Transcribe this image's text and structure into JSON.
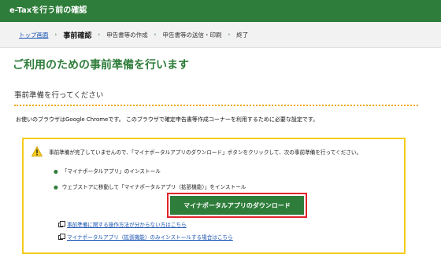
{
  "header": {
    "title": "e-Taxを行う前の確認"
  },
  "breadcrumb": {
    "top": "トップ画面",
    "current": "事前確認",
    "steps": [
      "申告書等の作成",
      "申告書等の送信・印刷",
      "終了"
    ]
  },
  "page_title": "ご利用のための事前準備を行います",
  "section_heading": "事前準備を行ってください",
  "browser_note": "お使いのブラウザはGoogle Chromeです。 このブラウザで確定申告書等作成コーナーを利用するために必要な設定です。",
  "notice": {
    "message": "事前準備が完了していませんので、「マイナポータルアプリのダウンロード」ボタンをクリックして、次の事前準備を行ってください。",
    "bullets": [
      "「マイナポータルアプリ」のインストール",
      "ウェブストアに移動して「マイナポータルアプリ（拡張機能）」をインストール"
    ],
    "download_button": "マイナポータルアプリのダウンロード",
    "links": [
      "事前準備に関する操作方法が分からない方はこちら",
      "マイナポータルアプリ（拡張機能）のみインストールする場合はこちら"
    ]
  },
  "colors": {
    "primary_green": "#2e7d3a",
    "warning_border": "#f5cc1c",
    "highlight_red": "#e0242a",
    "link_blue": "#1a55b3"
  }
}
